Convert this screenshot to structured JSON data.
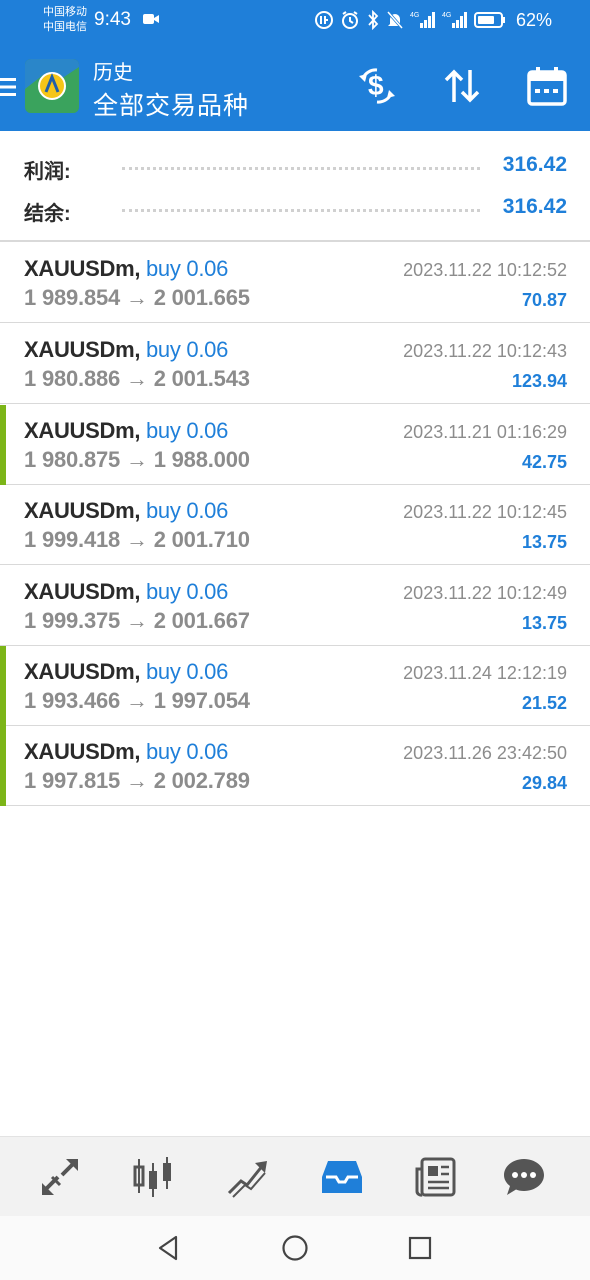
{
  "status": {
    "carrier1": "中国移动",
    "carrier2": "中国电信",
    "time": "9:43",
    "battery": "62%"
  },
  "header": {
    "title": "历史",
    "subtitle": "全部交易品种",
    "menu_icon": "hamburger-menu-icon",
    "actions": [
      "dollar-refresh-icon",
      "sort-icon",
      "calendar-icon"
    ]
  },
  "summary": {
    "profit_label": "利润:",
    "profit_value": "316.42",
    "balance_label": "结余:",
    "balance_value": "316.42"
  },
  "deals": [
    {
      "symbol": "XAUUSDm,",
      "side": "buy 0.06",
      "prices": "1 989.854 → 2 001.665",
      "time": "2023.11.22 10:12:52",
      "profit": "70.87",
      "accent": false
    },
    {
      "symbol": "XAUUSDm,",
      "side": "buy 0.06",
      "prices": "1 980.886 → 2 001.543",
      "time": "2023.11.22 10:12:43",
      "profit": "123.94",
      "accent": false
    },
    {
      "symbol": "XAUUSDm,",
      "side": "buy 0.06",
      "prices": "1 980.875 → 1 988.000",
      "time": "2023.11.21 01:16:29",
      "profit": "42.75",
      "accent": true
    },
    {
      "symbol": "XAUUSDm,",
      "side": "buy 0.06",
      "prices": "1 999.418 → 2 001.710",
      "time": "2023.11.22 10:12:45",
      "profit": "13.75",
      "accent": false
    },
    {
      "symbol": "XAUUSDm,",
      "side": "buy 0.06",
      "prices": "1 999.375 → 2 001.667",
      "time": "2023.11.22 10:12:49",
      "profit": "13.75",
      "accent": false
    },
    {
      "symbol": "XAUUSDm,",
      "side": "buy 0.06",
      "prices": "1 993.466 → 1 997.054",
      "time": "2023.11.24 12:12:19",
      "profit": "21.52",
      "accent": true
    },
    {
      "symbol": "XAUUSDm,",
      "side": "buy 0.06",
      "prices": "1 997.815 → 2 002.789",
      "time": "2023.11.26 23:42:50",
      "profit": "29.84",
      "accent": true
    }
  ],
  "tabs": [
    {
      "icon": "quotes-arrows-icon",
      "active": false
    },
    {
      "icon": "candlestick-chart-icon",
      "active": false
    },
    {
      "icon": "trade-trend-icon",
      "active": false
    },
    {
      "icon": "history-inbox-icon",
      "active": true
    },
    {
      "icon": "news-icon",
      "active": false
    },
    {
      "icon": "chat-bubble-icon",
      "active": false
    }
  ],
  "colors": {
    "primary": "#1f7fd9",
    "accent_green": "#7cb518",
    "text_dark": "#2b2b2b",
    "text_grey": "#8c8c8c"
  }
}
